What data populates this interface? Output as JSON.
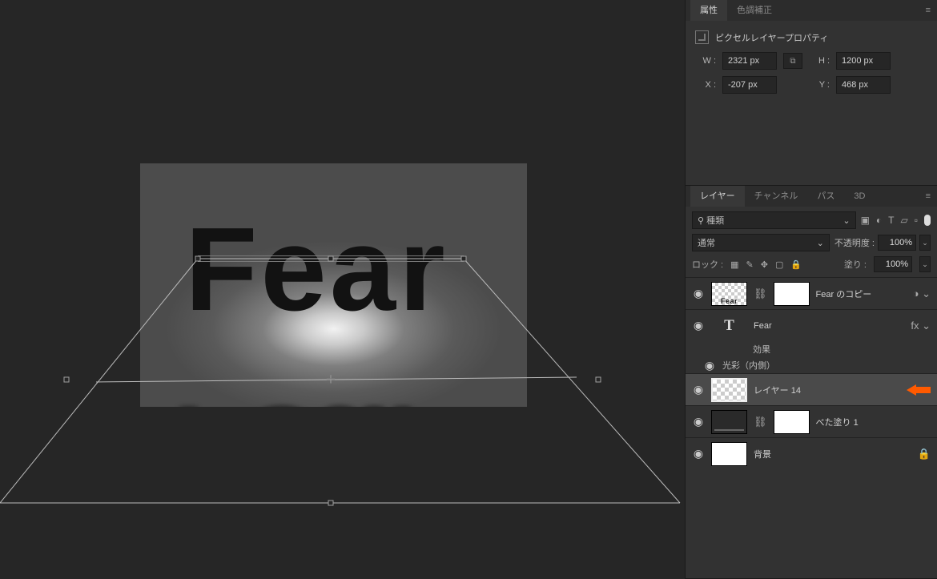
{
  "canvas": {
    "text": "Fear"
  },
  "properties": {
    "tab_attr": "属性",
    "tab_color": "色調補正",
    "section_title": "ピクセルレイヤープロパティ",
    "w_label": "W :",
    "w_value": "2321 px",
    "link_label": "⧉",
    "h_label": "H :",
    "h_value": "1200 px",
    "x_label": "X :",
    "x_value": "-207 px",
    "y_label": "Y :",
    "y_value": "468 px"
  },
  "layers_panel": {
    "tabs": {
      "layers": "レイヤー",
      "channels": "チャンネル",
      "paths": "パス",
      "threeD": "3D"
    },
    "filter_label": "種類",
    "blend_mode": "通常",
    "opacity_label": "不透明度 :",
    "opacity_value": "100%",
    "lock_label": "ロック :",
    "fill_label": "塗り :",
    "fill_value": "100%",
    "layers": [
      {
        "name": "Fear のコピー"
      },
      {
        "name": "Fear",
        "effects_label": "効果",
        "inner_glow": "光彩（内側）"
      },
      {
        "name": "レイヤー 14"
      },
      {
        "name": "べた塗り 1"
      },
      {
        "name": "背景"
      }
    ]
  }
}
